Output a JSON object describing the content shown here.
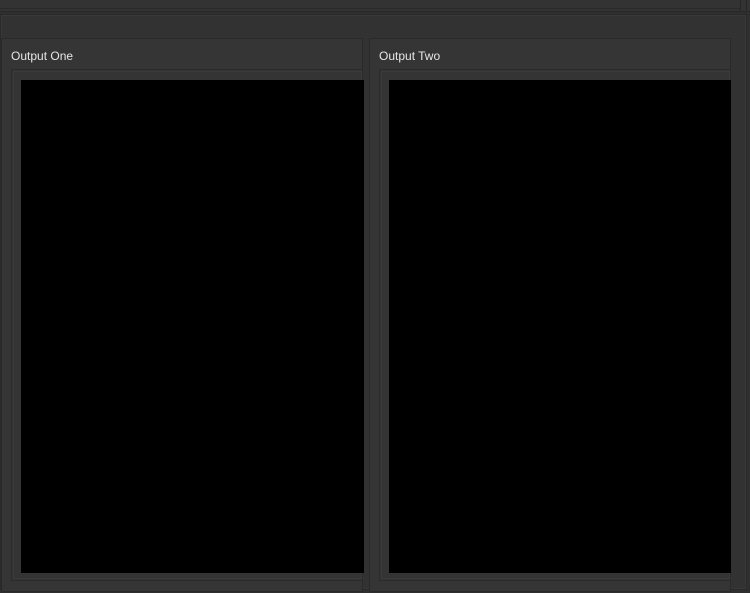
{
  "panels": [
    {
      "title": "Output One"
    },
    {
      "title": "Output Two"
    }
  ],
  "colors": {
    "background": "#2f2f2f",
    "panel": "#353535",
    "viewport": "#000000",
    "text": "#e6e6e6"
  }
}
